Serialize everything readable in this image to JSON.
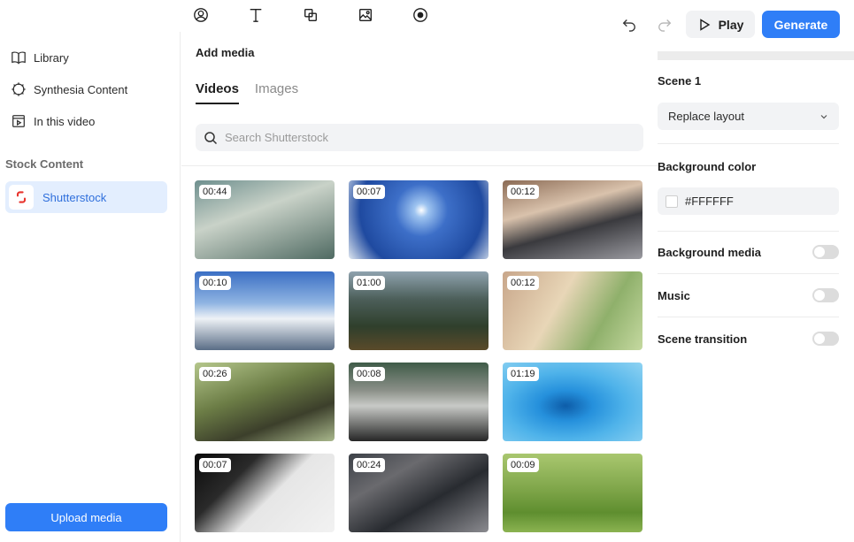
{
  "toolbar": {
    "play_label": "Play",
    "generate_label": "Generate"
  },
  "sidebar": {
    "items": [
      {
        "label": "Library",
        "icon": "book-icon"
      },
      {
        "label": "Synthesia Content",
        "icon": "gear-icon"
      },
      {
        "label": "In this video",
        "icon": "video-frame-icon"
      }
    ],
    "section_label": "Stock Content",
    "active_source": "Shutterstock",
    "upload_label": "Upload media"
  },
  "media": {
    "title": "Add media",
    "tabs": [
      {
        "label": "Videos",
        "active": true
      },
      {
        "label": "Images",
        "active": false
      }
    ],
    "search_placeholder": "Search Shutterstock",
    "videos": [
      {
        "duration": "00:44"
      },
      {
        "duration": "00:07"
      },
      {
        "duration": "00:12"
      },
      {
        "duration": "00:10"
      },
      {
        "duration": "01:00"
      },
      {
        "duration": "00:12"
      },
      {
        "duration": "00:26"
      },
      {
        "duration": "00:08"
      },
      {
        "duration": "01:19"
      },
      {
        "duration": "00:07"
      },
      {
        "duration": "00:24"
      },
      {
        "duration": "00:09"
      }
    ]
  },
  "scene": {
    "title": "Scene 1",
    "layout_select": "Replace layout",
    "background_color_label": "Background color",
    "background_color_value": "#FFFFFF",
    "toggles": [
      {
        "label": "Background media",
        "on": false
      },
      {
        "label": "Music",
        "on": false
      },
      {
        "label": "Scene transition",
        "on": false
      }
    ]
  },
  "colors": {
    "accent": "#2f7ef7",
    "active_bg": "#e3eefe"
  }
}
